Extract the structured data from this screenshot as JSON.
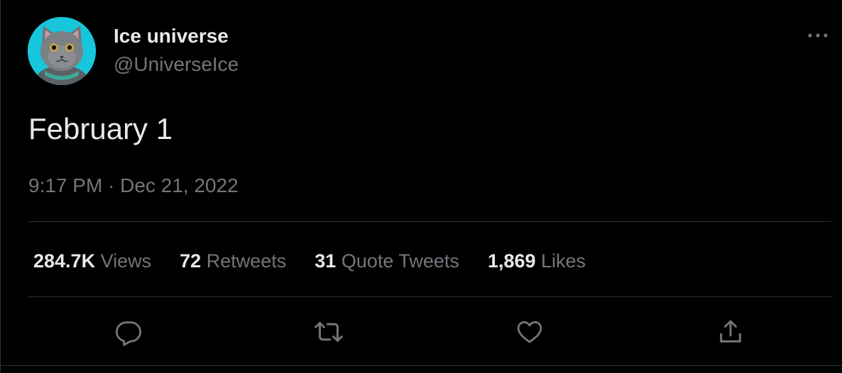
{
  "author": {
    "display_name": "Ice universe",
    "handle": "@UniverseIce",
    "avatar_icon": "cat-avatar",
    "avatar_bg_color": "#17c6dc"
  },
  "tweet": {
    "text": "February 1",
    "time": "9:17 PM",
    "separator": "·",
    "date": "Dec 21, 2022"
  },
  "stats": [
    {
      "value": "284.7K",
      "label": "Views"
    },
    {
      "value": "72",
      "label": "Retweets"
    },
    {
      "value": "31",
      "label": "Quote Tweets"
    },
    {
      "value": "1,869",
      "label": "Likes"
    }
  ],
  "actions": {
    "reply_icon": "reply-icon",
    "retweet_icon": "retweet-icon",
    "like_icon": "heart-icon",
    "share_icon": "share-icon",
    "more_icon": "more-options-icon"
  },
  "colors": {
    "background": "#000000",
    "primary_text": "#e7e9ea",
    "secondary_text": "#71767b",
    "border": "#2f3336"
  }
}
